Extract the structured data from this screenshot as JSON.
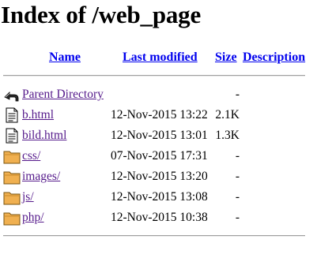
{
  "page": {
    "title": "Index of /web_page"
  },
  "columns": {
    "name": "Name",
    "last_modified": "Last modified",
    "size": "Size",
    "description": "Description"
  },
  "entries": [
    {
      "icon": "parent-directory-icon",
      "name": "Parent Directory",
      "modified": "",
      "size": "-"
    },
    {
      "icon": "file-icon",
      "name": "b.html",
      "modified": "12-Nov-2015 13:22",
      "size": "2.1K"
    },
    {
      "icon": "file-icon",
      "name": "bild.html",
      "modified": "12-Nov-2015 13:01",
      "size": "1.3K"
    },
    {
      "icon": "folder-icon",
      "name": "css/",
      "modified": "07-Nov-2015 17:31",
      "size": "-"
    },
    {
      "icon": "folder-icon",
      "name": "images/",
      "modified": "12-Nov-2015 13:20",
      "size": "-"
    },
    {
      "icon": "folder-icon",
      "name": "js/",
      "modified": "12-Nov-2015 13:08",
      "size": "-"
    },
    {
      "icon": "folder-icon",
      "name": "php/",
      "modified": "12-Nov-2015 10:38",
      "size": "-"
    }
  ],
  "colors": {
    "link_unvisited": "#0000ee",
    "link_visited": "#551a8b",
    "folder_fill": "#f0b050",
    "rule": "#a0a0a0"
  }
}
